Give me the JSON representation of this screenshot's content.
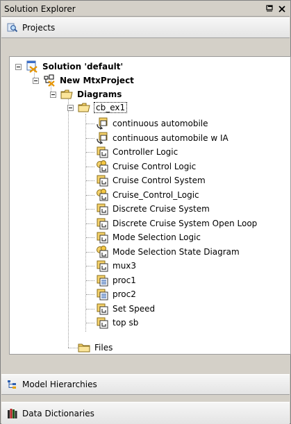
{
  "panel": {
    "title": "Solution Explorer",
    "pin_icon": "pin-icon",
    "close_icon": "close-icon"
  },
  "projects_bar": {
    "label": "Projects",
    "icon": "magnifier-icon"
  },
  "tree": {
    "solution": "Solution 'default'",
    "project": "New MtxProject",
    "diagrams": "Diagrams",
    "folder": "cb_ex1",
    "items": [
      {
        "label": "continuous automobile",
        "icon": "model-link-icon"
      },
      {
        "label": "continuous automobile w IA",
        "icon": "model-link-icon"
      },
      {
        "label": "Controller Logic",
        "icon": "diagram-icon"
      },
      {
        "label": "Cruise Control Logic",
        "icon": "statechart-icon"
      },
      {
        "label": "Cruise Control System",
        "icon": "diagram-icon"
      },
      {
        "label": "Cruise_Control_Logic",
        "icon": "statechart-icon"
      },
      {
        "label": "Discrete Cruise System",
        "icon": "diagram-icon"
      },
      {
        "label": "Discrete Cruise System Open Loop",
        "icon": "diagram-icon"
      },
      {
        "label": "Mode Selection Logic",
        "icon": "diagram-icon"
      },
      {
        "label": "Mode Selection State Diagram",
        "icon": "statechart-icon"
      },
      {
        "label": "mux3",
        "icon": "diagram-icon"
      },
      {
        "label": "proc1",
        "icon": "procedure-icon"
      },
      {
        "label": "proc2",
        "icon": "procedure-icon"
      },
      {
        "label": "Set Speed",
        "icon": "diagram-icon"
      },
      {
        "label": "top sb",
        "icon": "diagram-icon"
      }
    ],
    "files": "Files"
  },
  "model_hierarchies_bar": {
    "label": "Model Hierarchies",
    "icon": "hierarchy-icon"
  },
  "data_dictionaries_bar": {
    "label": "Data Dictionaries",
    "icon": "books-icon"
  }
}
